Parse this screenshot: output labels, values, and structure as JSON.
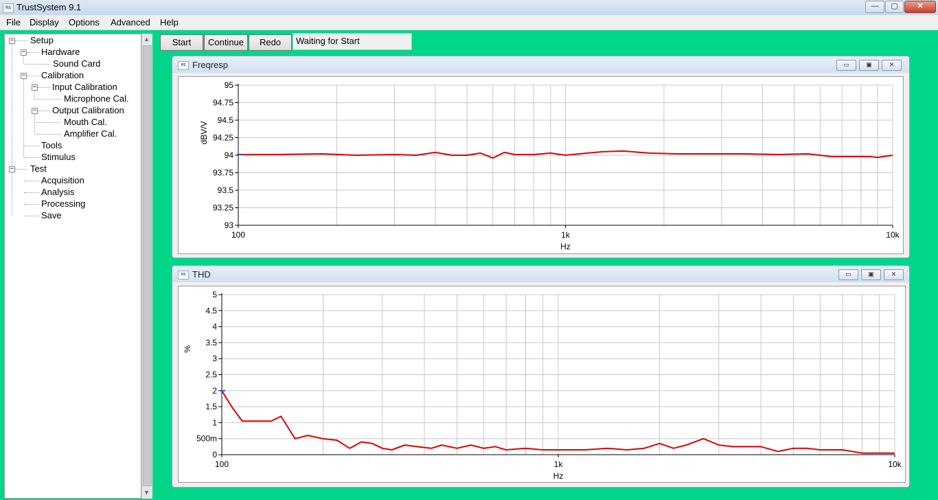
{
  "window": {
    "title": "TrustSystem 9.1",
    "app_icon_text": "RS",
    "minimize": "—",
    "maximize": "▢",
    "close": "✕"
  },
  "menu": [
    "File",
    "Display",
    "Options",
    "Advanced",
    "Help"
  ],
  "tree": [
    {
      "label": "Setup",
      "toggle": "−"
    },
    {
      "label": "Hardware",
      "toggle": "−"
    },
    {
      "label": "Sound Card"
    },
    {
      "label": "Calibration",
      "toggle": "−"
    },
    {
      "label": "Input Calibration",
      "toggle": "−"
    },
    {
      "label": "Microphone Cal."
    },
    {
      "label": "Output Calibration",
      "toggle": "−"
    },
    {
      "label": "Mouth Cal."
    },
    {
      "label": "Amplifier Cal."
    },
    {
      "label": "Tools"
    },
    {
      "label": "Stimulus"
    },
    {
      "label": "Test",
      "toggle": "−"
    },
    {
      "label": "Acquisition"
    },
    {
      "label": "Analysis"
    },
    {
      "label": "Processing"
    },
    {
      "label": "Save"
    }
  ],
  "toolbar": {
    "start": "Start",
    "continue": "Continue",
    "redo": "Redo",
    "status": "Waiting for Start"
  },
  "chart_window_buttons": {
    "minimize": "▭",
    "restore": "▣",
    "close": "✕"
  },
  "chart_data": [
    {
      "type": "line",
      "window_title": "Freqresp",
      "xlabel": "Hz",
      "ylabel": "dBV/V",
      "x_scale": "log",
      "xlim": [
        100,
        10000
      ],
      "ylim": [
        93,
        95
      ],
      "x_ticks": [
        100,
        1000,
        10000
      ],
      "x_tick_labels": [
        "100",
        "1k",
        "10k"
      ],
      "y_ticks": [
        95,
        94.75,
        94.5,
        94.25,
        94,
        93.75,
        93.5,
        93.25,
        93
      ],
      "y_tick_labels": [
        "95",
        "94.75",
        "94.5",
        "94.25",
        "94",
        "93.75",
        "93.5",
        "93.25",
        "93"
      ],
      "grid": true,
      "line_color": "#e00000",
      "series": [
        {
          "x": [
            100,
            130,
            180,
            230,
            300,
            350,
            400,
            450,
            500,
            550,
            600,
            650,
            700,
            800,
            900,
            1000,
            1100,
            1300,
            1500,
            1800,
            2200,
            2800,
            3500,
            4500,
            5500,
            6500,
            7500,
            8500,
            9000,
            10000
          ],
          "values": [
            94.01,
            94.01,
            94.02,
            94.0,
            94.01,
            94.0,
            94.04,
            94.0,
            94.0,
            94.03,
            93.96,
            94.04,
            94.01,
            94.01,
            94.03,
            94.0,
            94.02,
            94.05,
            94.06,
            94.03,
            94.02,
            94.02,
            94.02,
            94.01,
            94.02,
            93.98,
            93.98,
            93.98,
            93.97,
            94.0
          ]
        }
      ]
    },
    {
      "type": "line",
      "window_title": "THD",
      "xlabel": "Hz",
      "ylabel": "%",
      "x_scale": "log",
      "xlim": [
        100,
        10000
      ],
      "ylim": [
        0,
        5
      ],
      "x_ticks": [
        100,
        1000,
        10000
      ],
      "x_tick_labels": [
        "100",
        "1k",
        "10k"
      ],
      "y_ticks": [
        5,
        4.5,
        4,
        3.5,
        3,
        2.5,
        2,
        1.5,
        1,
        0.5,
        0
      ],
      "y_tick_labels": [
        "5",
        "4.5",
        "4",
        "3.5",
        "3",
        "2.5",
        "2",
        "1.5",
        "1",
        "500m",
        "0"
      ],
      "grid": true,
      "line_color": "#e00000",
      "series": [
        {
          "x": [
            100,
            107,
            115,
            125,
            140,
            150,
            165,
            180,
            200,
            220,
            240,
            260,
            280,
            300,
            320,
            350,
            380,
            420,
            450,
            500,
            550,
            600,
            650,
            700,
            800,
            900,
            1000,
            1100,
            1200,
            1400,
            1600,
            1800,
            2000,
            2200,
            2400,
            2700,
            3000,
            3300,
            3600,
            4000,
            4500,
            5000,
            5500,
            6000,
            7000,
            8000,
            9000,
            10000
          ],
          "values": [
            2.0,
            1.5,
            1.05,
            1.05,
            1.05,
            1.2,
            0.5,
            0.6,
            0.5,
            0.45,
            0.2,
            0.4,
            0.35,
            0.2,
            0.15,
            0.3,
            0.25,
            0.2,
            0.3,
            0.2,
            0.3,
            0.2,
            0.25,
            0.15,
            0.2,
            0.15,
            0.15,
            0.15,
            0.15,
            0.2,
            0.15,
            0.2,
            0.35,
            0.2,
            0.3,
            0.5,
            0.3,
            0.25,
            0.25,
            0.25,
            0.1,
            0.2,
            0.2,
            0.15,
            0.15,
            0.05,
            0.05,
            0.05
          ]
        }
      ]
    }
  ]
}
